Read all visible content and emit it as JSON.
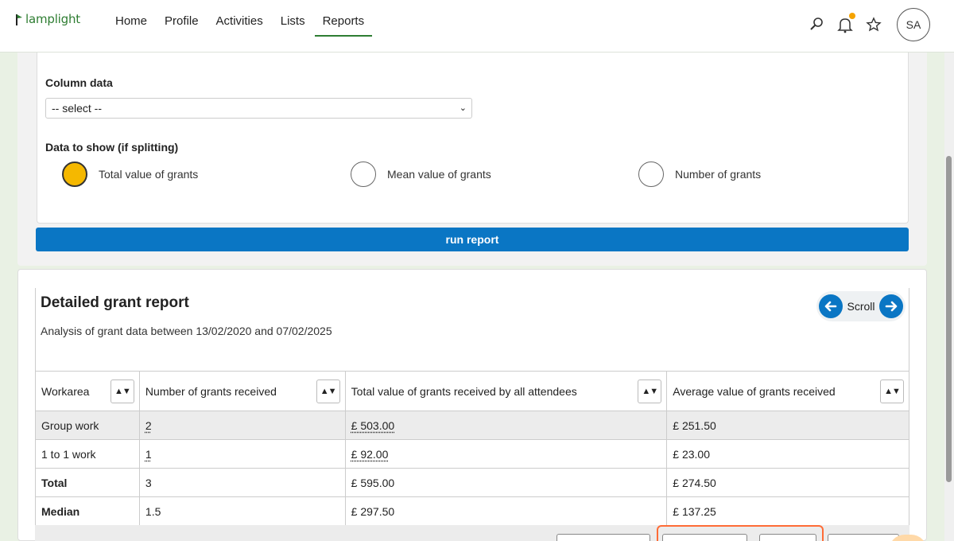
{
  "app": {
    "logo_text": "lamplight"
  },
  "nav": {
    "items": [
      {
        "label": "Home"
      },
      {
        "label": "Profile"
      },
      {
        "label": "Activities"
      },
      {
        "label": "Lists"
      },
      {
        "label": "Reports",
        "active": true
      }
    ]
  },
  "user": {
    "initials": "SA"
  },
  "options": {
    "column_data_label": "Column data",
    "column_select_value": "-- select --",
    "data_to_show_label": "Data to show (if splitting)",
    "radios": [
      {
        "label": "Total value of grants",
        "checked": true
      },
      {
        "label": "Mean value of grants",
        "checked": false
      },
      {
        "label": "Number of grants",
        "checked": false
      }
    ],
    "run_button": "run report"
  },
  "report": {
    "title": "Detailed grant report",
    "subtitle": "Analysis of grant data between 13/02/2020 and 07/02/2025",
    "scroll_label": "Scroll",
    "columns": [
      "Workarea",
      "Number of grants received",
      "Total value of grants received by all attendees",
      "Average value of grants received"
    ],
    "rows": [
      {
        "workarea": "Group work",
        "count": "2",
        "total": "£ 503.00",
        "average": "£ 251.50"
      },
      {
        "workarea": "1 to 1 work",
        "count": "1",
        "total": "£ 92.00",
        "average": "£ 23.00"
      }
    ],
    "summary": [
      {
        "label": "Total",
        "count": "3",
        "total": "£ 595.00",
        "average": "£ 274.50"
      },
      {
        "label": "Median",
        "count": "1.5",
        "total": "£ 297.50",
        "average": "£ 137.25"
      }
    ]
  },
  "colors": {
    "brand_green": "#2e7d32",
    "primary_blue": "#0a76c4",
    "radio_fill": "#f5b800",
    "highlight": "#ff6c37"
  }
}
